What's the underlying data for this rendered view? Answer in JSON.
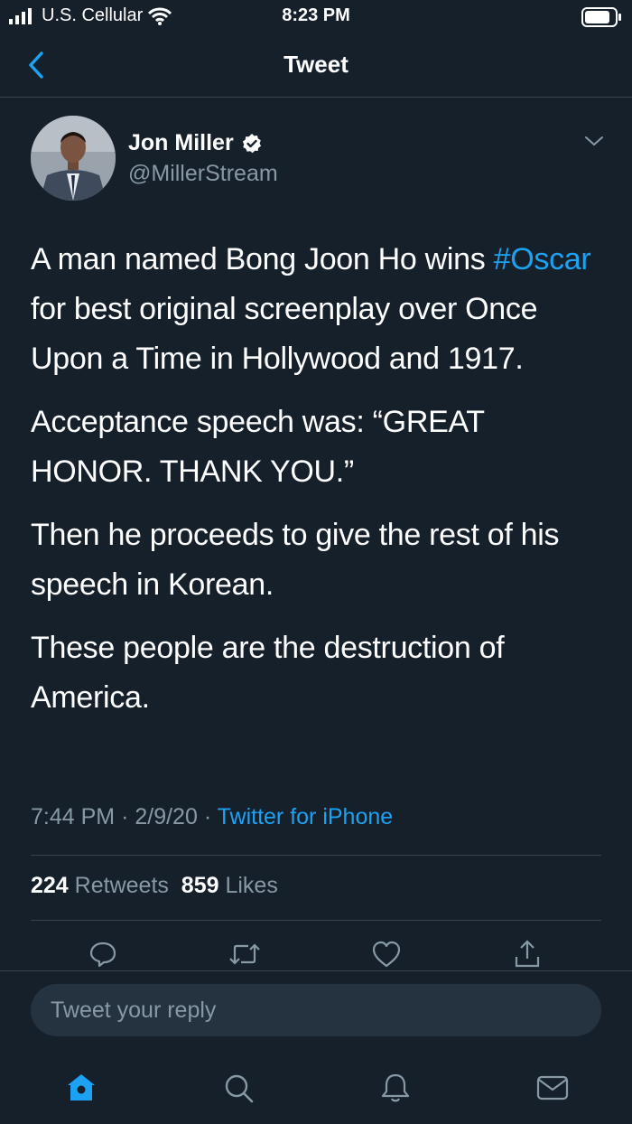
{
  "status_bar": {
    "carrier": "U.S. Cellular",
    "time": "8:23 PM",
    "icons": [
      "signal-icon",
      "wifi-icon",
      "battery-icon"
    ]
  },
  "nav": {
    "title": "Tweet",
    "back_icon": "back-chevron-icon"
  },
  "tweet": {
    "author_name": "Jon Miller",
    "verified_icon": "verified-badge-icon",
    "handle": "@MillerStream",
    "body": {
      "p1_before": "A man named Bong Joon Ho wins",
      "hashtag": "#Oscar",
      "p1_after": "for best original screenplay over Once Upon a Time in Hollywood and 1917.",
      "p2": "Acceptance speech was: “GREAT HONOR. THANK YOU.”",
      "p3": "Then he proceeds to give the rest of his speech in Korean.",
      "p4": "These people are the destruction of America."
    },
    "time": "7:44 PM",
    "separator": "·",
    "date": "2/9/20",
    "source": "Twitter for iPhone",
    "retweets_count": "224",
    "retweets_label": "Retweets",
    "likes_count": "859",
    "likes_label": "Likes"
  },
  "actions": [
    "reply-icon",
    "retweet-icon",
    "like-icon",
    "share-icon"
  ],
  "composer": {
    "placeholder": "Tweet your reply"
  },
  "tabbar": [
    "home-icon",
    "search-icon",
    "notifications-icon",
    "messages-icon"
  ],
  "colors": {
    "background": "#15202b",
    "accent": "#1da1f2",
    "secondary_text": "#8899a6",
    "divider": "#38444d"
  }
}
